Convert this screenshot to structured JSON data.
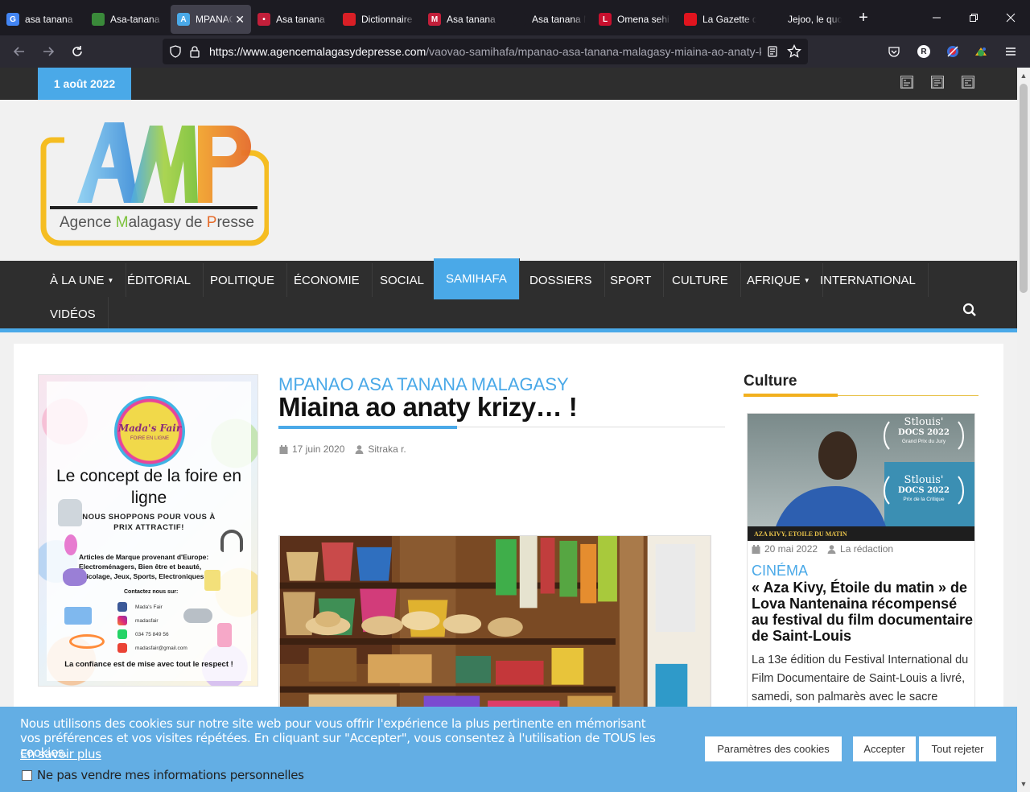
{
  "browser": {
    "tabs": [
      {
        "title": "asa tanana",
        "favicon_color": "#4285f4",
        "favicon_glyph": "G"
      },
      {
        "title": "Asa-tanana",
        "favicon_color": "#3a8a3a",
        "favicon_glyph": ""
      },
      {
        "title": "MPANAO",
        "favicon_color": "#4aa9e8",
        "favicon_glyph": "A"
      },
      {
        "title": "Asa tanana",
        "favicon_color": "#c21f3a",
        "favicon_glyph": "•"
      },
      {
        "title": "Dictionnaire",
        "favicon_color": "#d91f26",
        "favicon_glyph": ""
      },
      {
        "title": "Asa tanana",
        "favicon_color": "#c21f3a",
        "favicon_glyph": "M"
      },
      {
        "title": "Asa tanana Mala",
        "favicon_color": "#1c1b22",
        "favicon_glyph": ""
      },
      {
        "title": "Omena sehi",
        "favicon_color": "#c8102e",
        "favicon_glyph": "L"
      },
      {
        "title": "La Gazette d",
        "favicon_color": "#e0141e",
        "favicon_glyph": ""
      },
      {
        "title": "Jejoo, le quotidi",
        "favicon_color": "#1c1b22",
        "favicon_glyph": ""
      }
    ],
    "url_host": "https://www.agencemalagasydepresse.com",
    "url_path": "/vaovao-samihafa/mpanao-asa-tanana-malagasy-miaina-ao-anaty-k",
    "extension_r_label": "R"
  },
  "site": {
    "date": "1 août 2022",
    "logo_letters": "AMP",
    "logo_text": "Agence Malagasy de Presse",
    "nav": [
      {
        "label": "À LA UNE",
        "caret": true,
        "active": false
      },
      {
        "label": "ÉDITORIAL",
        "caret": false,
        "active": false
      },
      {
        "label": "POLITIQUE",
        "caret": false,
        "active": false
      },
      {
        "label": "ÉCONOMIE",
        "caret": false,
        "active": false
      },
      {
        "label": "SOCIAL",
        "caret": false,
        "active": false
      },
      {
        "label": "SAMIHAFA",
        "caret": false,
        "active": true
      },
      {
        "label": "DOSSIERS",
        "caret": false,
        "active": false
      },
      {
        "label": "SPORT",
        "caret": false,
        "active": false
      },
      {
        "label": "CULTURE",
        "caret": false,
        "active": false
      },
      {
        "label": "AFRIQUE",
        "caret": true,
        "active": false
      },
      {
        "label": "INTERNATIONAL",
        "caret": false,
        "active": false
      },
      {
        "label": "VIDÉOS",
        "caret": false,
        "active": false
      }
    ],
    "accent_color": "#4aa9e8",
    "dark_color": "#2e2e2e"
  },
  "ad": {
    "badge_line1": "Mada's Fair",
    "badge_line2": "FOIRE EN LIGNE",
    "title": "Le concept de la foire en ligne",
    "subtitle": "NOUS SHOPPONS POUR VOUS À PRIX ATTRACTIF!",
    "items": "Articles de Marque provenant d'Europe: Electroménagers, Bien être et beauté, Bricolage, Jeux, Sports, Electroniques,...",
    "contact_title": "Contactez nous sur:",
    "contacts": [
      "Mada's Fair",
      "madasfair",
      "034 75 849 56",
      "madasfair@gmail.com"
    ],
    "footer": "La confiance est de mise avec tout le respect !"
  },
  "article": {
    "category": "MPANAO ASA TANANA MALAGASY",
    "title": "Miaina ao anaty krizy… !",
    "date": "17 juin 2020",
    "author": "Sitraka r."
  },
  "sidebar": {
    "title": "Culture",
    "card": {
      "image_caption": "AZA KIVY, ETOILE DU MATIN",
      "laurel1_title": "Stlouis'",
      "laurel1_sub": "DOCS 2022",
      "laurel1_award": "Grand Prix du Jury",
      "laurel2_title": "Stlouis'",
      "laurel2_sub": "DOCS 2022",
      "laurel2_award": "Prix de la Critique",
      "date": "20 mai 2022",
      "author": "La rédaction",
      "category": "CINÉMA",
      "headline": "« Aza Kivy, Étoile du matin » de Lova Nantenaina récompensé au festival du film documentaire de Saint-Louis",
      "excerpt": "La 13e édition du Festival International du Film Documentaire de Saint-Louis a livré, samedi, son palmarès avec le sacre"
    }
  },
  "cookie": {
    "text": "Nous utilisons des cookies sur notre site web pour vous offrir l'expérience la plus pertinente en mémorisant vos préférences et vos visites répétées. En cliquant sur \"Accepter\", vous consentez à l'utilisation de TOUS les cookies.",
    "link": "En savoir plus",
    "checkbox_label": "Ne pas vendre mes informations personnelles",
    "settings_label": "Paramètres des cookies",
    "accept_label": "Accepter",
    "reject_label": "Tout rejeter"
  }
}
